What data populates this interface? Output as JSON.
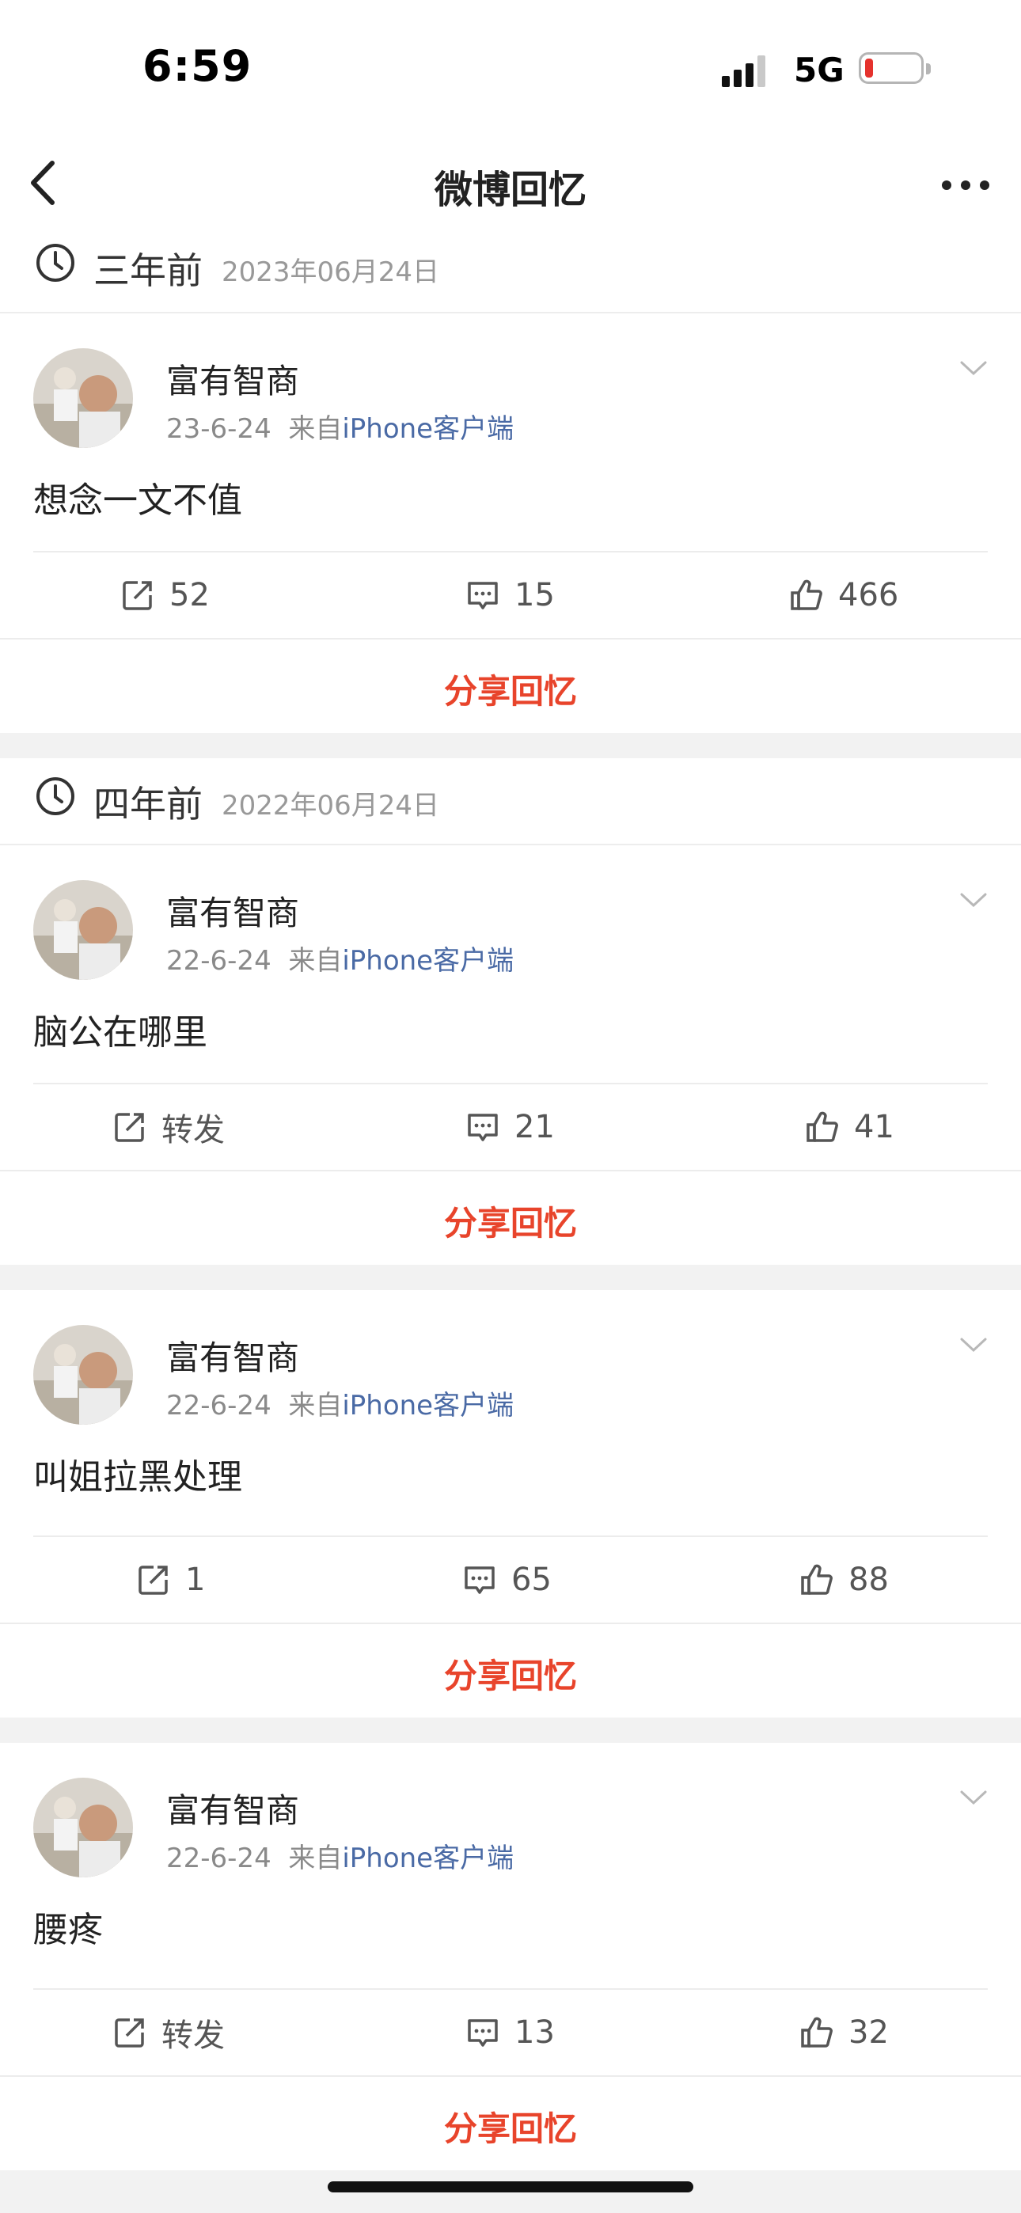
{
  "status_bar": {
    "time": "6:59",
    "network": "5G",
    "battery_color": "#e5322d"
  },
  "nav": {
    "title": "微博回忆",
    "back_icon": "chevron-left-icon",
    "more_icon": "more-dots-icon"
  },
  "accent_color": "#e8442b",
  "link_color": "#4a6aa5",
  "sections": [
    {
      "ago": "三年前",
      "date": "2023年06月24日"
    },
    {
      "ago": "四年前",
      "date": "2022年06月24日"
    }
  ],
  "posts": [
    {
      "user": "富有智商",
      "time": "23-6-24",
      "via": "来自",
      "source": "iPhone客户端",
      "text": "想念一文不值",
      "repost": "52",
      "comment": "15",
      "like": "466",
      "share": "分享回忆"
    },
    {
      "user": "富有智商",
      "time": "22-6-24",
      "via": "来自",
      "source": "iPhone客户端",
      "text": "脑公在哪里",
      "repost": "转发",
      "comment": "21",
      "like": "41",
      "share": "分享回忆"
    },
    {
      "user": "富有智商",
      "time": "22-6-24",
      "via": "来自",
      "source": "iPhone客户端",
      "text": "叫姐拉黑处理",
      "repost": "1",
      "comment": "65",
      "like": "88",
      "share": "分享回忆"
    },
    {
      "user": "富有智商",
      "time": "22-6-24",
      "via": "来自",
      "source": "iPhone客户端",
      "text": "腰疼",
      "repost": "转发",
      "comment": "13",
      "like": "32",
      "share": "分享回忆"
    }
  ]
}
